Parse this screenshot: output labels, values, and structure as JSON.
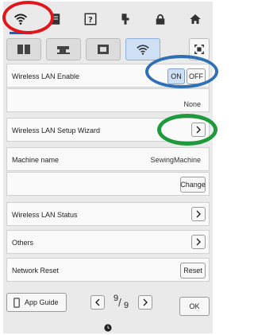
{
  "top_tabs": [
    {
      "icon": "wifi-icon",
      "active": true
    },
    {
      "icon": "page-icon",
      "active": false
    },
    {
      "icon": "help-icon",
      "active": false
    },
    {
      "icon": "embroidery-icon",
      "active": false
    },
    {
      "icon": "lock-icon",
      "active": false
    },
    {
      "icon": "home-icon",
      "active": false
    }
  ],
  "sub_tabs": [
    {
      "icon": "book-icon",
      "active": false
    },
    {
      "icon": "sewing-machine-icon",
      "active": false
    },
    {
      "icon": "embroidery-frame-icon",
      "active": false
    },
    {
      "icon": "wifi-icon",
      "active": true
    }
  ],
  "wireless_lan_enable": {
    "label": "Wireless LAN Enable",
    "on_label": "ON",
    "off_label": "OFF",
    "state": "ON"
  },
  "network_name": {
    "value": "None"
  },
  "setup_wizard": {
    "label": "Wireless LAN Setup Wizard"
  },
  "machine_name": {
    "label": "Machine name",
    "value": "SewingMachine",
    "change_label": "Change"
  },
  "lan_status": {
    "label": "Wireless LAN Status"
  },
  "others": {
    "label": "Others"
  },
  "network_reset": {
    "label": "Network Reset",
    "button_label": "Reset"
  },
  "footer": {
    "app_guide_label": "App Guide",
    "page_current": "9",
    "page_total": "9",
    "ok_label": "OK"
  },
  "highlights": {
    "red": "#e0161b",
    "blue": "#2f6fb3",
    "green": "#1e9a3c"
  }
}
